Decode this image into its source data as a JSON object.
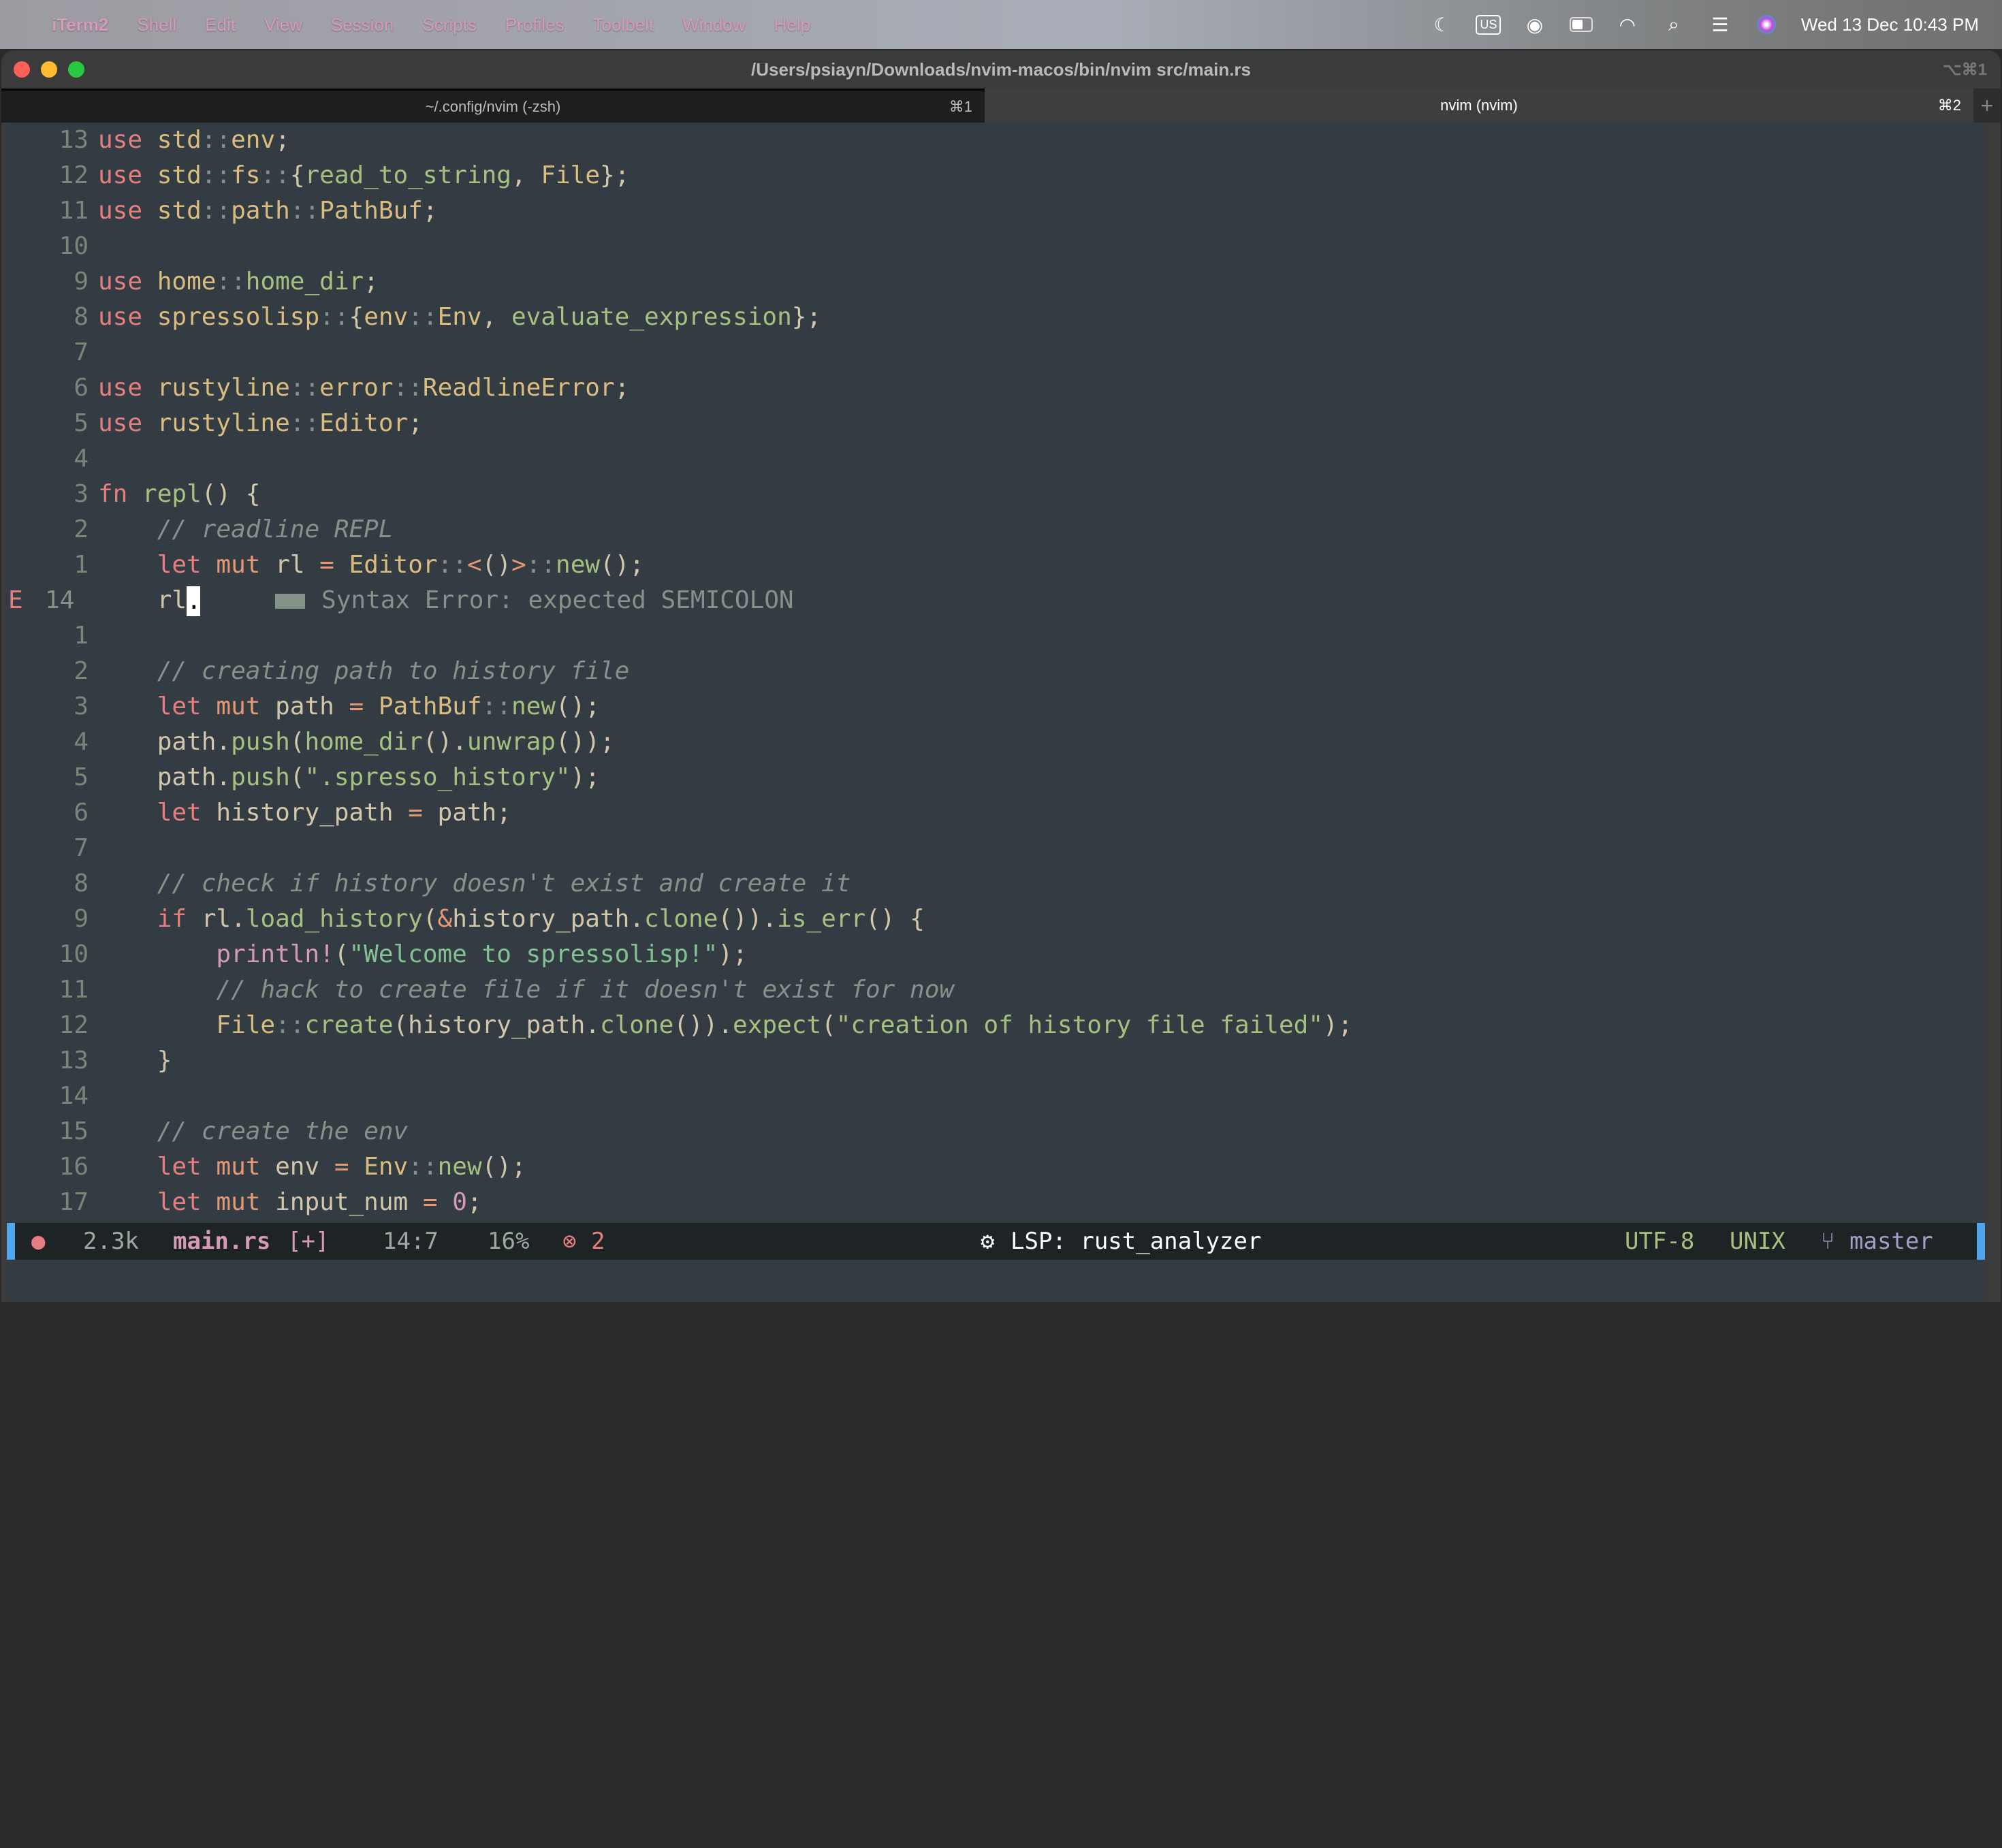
{
  "menubar": {
    "app": "iTerm2",
    "items": [
      "Shell",
      "Edit",
      "View",
      "Session",
      "Scripts",
      "Profiles",
      "Toolbelt",
      "Window",
      "Help"
    ],
    "input_source": "US",
    "datetime": "Wed 13 Dec  10:43 PM"
  },
  "window": {
    "title": "/Users/psiayn/Downloads/nvim-macos/bin/nvim src/main.rs",
    "shortcut": "⌥⌘1",
    "tabs": [
      {
        "label": "~/.config/nvim (-zsh)",
        "shortcut": "⌘1",
        "active": false
      },
      {
        "label": "nvim (nvim)",
        "shortcut": "⌘2",
        "active": true
      }
    ],
    "add_tab": "+"
  },
  "editor": {
    "lines": [
      {
        "nr": "13",
        "tokens": [
          [
            "k",
            "use"
          ],
          [
            "n",
            " "
          ],
          [
            "t",
            "std"
          ],
          [
            "p",
            "::"
          ],
          [
            "t",
            "env"
          ],
          [
            "n",
            ";"
          ]
        ]
      },
      {
        "nr": "12",
        "tokens": [
          [
            "k",
            "use"
          ],
          [
            "n",
            " "
          ],
          [
            "t",
            "std"
          ],
          [
            "p",
            "::"
          ],
          [
            "t",
            "fs"
          ],
          [
            "p",
            "::"
          ],
          [
            "n",
            "{"
          ],
          [
            "f",
            "read_to_string"
          ],
          [
            "n",
            ", "
          ],
          [
            "t",
            "File"
          ],
          [
            "n",
            "};"
          ]
        ]
      },
      {
        "nr": "11",
        "tokens": [
          [
            "k",
            "use"
          ],
          [
            "n",
            " "
          ],
          [
            "t",
            "std"
          ],
          [
            "p",
            "::"
          ],
          [
            "t",
            "path"
          ],
          [
            "p",
            "::"
          ],
          [
            "t",
            "PathBuf"
          ],
          [
            "n",
            ";"
          ]
        ]
      },
      {
        "nr": "10",
        "tokens": []
      },
      {
        "nr": "9",
        "tokens": [
          [
            "k",
            "use"
          ],
          [
            "n",
            " "
          ],
          [
            "t",
            "home"
          ],
          [
            "p",
            "::"
          ],
          [
            "f",
            "home_dir"
          ],
          [
            "n",
            ";"
          ]
        ]
      },
      {
        "nr": "8",
        "tokens": [
          [
            "k",
            "use"
          ],
          [
            "n",
            " "
          ],
          [
            "t",
            "spressolisp"
          ],
          [
            "p",
            "::"
          ],
          [
            "n",
            "{"
          ],
          [
            "t",
            "env"
          ],
          [
            "p",
            "::"
          ],
          [
            "t",
            "Env"
          ],
          [
            "n",
            ", "
          ],
          [
            "f",
            "evaluate_expression"
          ],
          [
            "n",
            "};"
          ]
        ]
      },
      {
        "nr": "7",
        "tokens": []
      },
      {
        "nr": "6",
        "tokens": [
          [
            "k",
            "use"
          ],
          [
            "n",
            " "
          ],
          [
            "t",
            "rustyline"
          ],
          [
            "p",
            "::"
          ],
          [
            "t",
            "error"
          ],
          [
            "p",
            "::"
          ],
          [
            "t",
            "ReadlineError"
          ],
          [
            "n",
            ";"
          ]
        ]
      },
      {
        "nr": "5",
        "tokens": [
          [
            "k",
            "use"
          ],
          [
            "n",
            " "
          ],
          [
            "t",
            "rustyline"
          ],
          [
            "p",
            "::"
          ],
          [
            "t",
            "Editor"
          ],
          [
            "n",
            ";"
          ]
        ]
      },
      {
        "nr": "4",
        "tokens": []
      },
      {
        "nr": "3",
        "tokens": [
          [
            "k",
            "fn"
          ],
          [
            "n",
            " "
          ],
          [
            "f",
            "repl"
          ],
          [
            "n",
            "() {"
          ]
        ]
      },
      {
        "nr": "2",
        "tokens": [
          [
            "n",
            "    "
          ],
          [
            "c",
            "// readline REPL"
          ]
        ]
      },
      {
        "nr": "1",
        "tokens": [
          [
            "n",
            "    "
          ],
          [
            "k",
            "let"
          ],
          [
            "n",
            " "
          ],
          [
            "o",
            "mut"
          ],
          [
            "n",
            " rl "
          ],
          [
            "o",
            "="
          ],
          [
            "n",
            " "
          ],
          [
            "t",
            "Editor"
          ],
          [
            "p",
            "::"
          ],
          [
            "o",
            "<"
          ],
          [
            "n",
            "()"
          ],
          [
            "o",
            ">"
          ],
          [
            "p",
            "::"
          ],
          [
            "f",
            "new"
          ],
          [
            "n",
            "();"
          ]
        ]
      },
      {
        "nr": "14",
        "current": true,
        "sign": "E",
        "tokens": [
          [
            "n",
            "    rl"
          ]
        ],
        "cursor_char": ".",
        "virtual_text": "Syntax Error: expected SEMICOLON"
      },
      {
        "nr": "1",
        "tokens": []
      },
      {
        "nr": "2",
        "tokens": [
          [
            "n",
            "    "
          ],
          [
            "c",
            "// creating path to history file"
          ]
        ]
      },
      {
        "nr": "3",
        "tokens": [
          [
            "n",
            "    "
          ],
          [
            "k",
            "let"
          ],
          [
            "n",
            " "
          ],
          [
            "o",
            "mut"
          ],
          [
            "n",
            " path "
          ],
          [
            "o",
            "="
          ],
          [
            "n",
            " "
          ],
          [
            "t",
            "PathBuf"
          ],
          [
            "p",
            "::"
          ],
          [
            "f",
            "new"
          ],
          [
            "n",
            "();"
          ]
        ]
      },
      {
        "nr": "4",
        "tokens": [
          [
            "n",
            "    path."
          ],
          [
            "f",
            "push"
          ],
          [
            "n",
            "("
          ],
          [
            "f",
            "home_dir"
          ],
          [
            "n",
            "()."
          ],
          [
            "f",
            "unwrap"
          ],
          [
            "n",
            "());"
          ]
        ]
      },
      {
        "nr": "5",
        "tokens": [
          [
            "n",
            "    path."
          ],
          [
            "f",
            "push"
          ],
          [
            "n",
            "("
          ],
          [
            "s2",
            "\".spresso_history\""
          ],
          [
            "n",
            ");"
          ]
        ]
      },
      {
        "nr": "6",
        "tokens": [
          [
            "n",
            "    "
          ],
          [
            "k",
            "let"
          ],
          [
            "n",
            " history_path "
          ],
          [
            "o",
            "="
          ],
          [
            "n",
            " path;"
          ]
        ]
      },
      {
        "nr": "7",
        "tokens": []
      },
      {
        "nr": "8",
        "tokens": [
          [
            "n",
            "    "
          ],
          [
            "c",
            "// check if history doesn't exist and create it"
          ]
        ]
      },
      {
        "nr": "9",
        "tokens": [
          [
            "n",
            "    "
          ],
          [
            "k",
            "if"
          ],
          [
            "n",
            " rl."
          ],
          [
            "f",
            "load_history"
          ],
          [
            "n",
            "("
          ],
          [
            "o",
            "&"
          ],
          [
            "n",
            "history_path."
          ],
          [
            "f",
            "clone"
          ],
          [
            "n",
            "())."
          ],
          [
            "f",
            "is_err"
          ],
          [
            "n",
            "() {"
          ]
        ]
      },
      {
        "nr": "10",
        "tokens": [
          [
            "n",
            "        "
          ],
          [
            "m",
            "println!"
          ],
          [
            "n",
            "("
          ],
          [
            "s",
            "\"Welcome to spressolisp!\""
          ],
          [
            "n",
            ");"
          ]
        ]
      },
      {
        "nr": "11",
        "tokens": [
          [
            "n",
            "        "
          ],
          [
            "c",
            "// hack to create file if it doesn't exist for now"
          ]
        ]
      },
      {
        "nr": "12",
        "tokens": [
          [
            "n",
            "        "
          ],
          [
            "t",
            "File"
          ],
          [
            "p",
            "::"
          ],
          [
            "f",
            "create"
          ],
          [
            "n",
            "(history_path."
          ],
          [
            "f",
            "clone"
          ],
          [
            "n",
            "())."
          ],
          [
            "f",
            "expect"
          ],
          [
            "n",
            "("
          ],
          [
            "s2",
            "\"creation of history file failed\""
          ],
          [
            "n",
            ");"
          ]
        ]
      },
      {
        "nr": "13",
        "tokens": [
          [
            "n",
            "    }"
          ]
        ]
      },
      {
        "nr": "14",
        "tokens": []
      },
      {
        "nr": "15",
        "tokens": [
          [
            "n",
            "    "
          ],
          [
            "c",
            "// create the env"
          ]
        ]
      },
      {
        "nr": "16",
        "tokens": [
          [
            "n",
            "    "
          ],
          [
            "k",
            "let"
          ],
          [
            "n",
            " "
          ],
          [
            "o",
            "mut"
          ],
          [
            "n",
            " env "
          ],
          [
            "o",
            "="
          ],
          [
            "n",
            " "
          ],
          [
            "t",
            "Env"
          ],
          [
            "p",
            "::"
          ],
          [
            "f",
            "new"
          ],
          [
            "n",
            "();"
          ]
        ]
      },
      {
        "nr": "17",
        "tokens": [
          [
            "n",
            "    "
          ],
          [
            "k",
            "let"
          ],
          [
            "n",
            " "
          ],
          [
            "o",
            "mut"
          ],
          [
            "n",
            " input_num "
          ],
          [
            "o",
            "="
          ],
          [
            "n",
            " "
          ],
          [
            "num",
            "0"
          ],
          [
            "n",
            ";"
          ]
        ]
      }
    ]
  },
  "statusline": {
    "size": "2.3k",
    "filename": "main.rs",
    "modified": "[+]",
    "position": "14:7",
    "percent": "16%",
    "errors": "2",
    "lsp": "LSP: rust_analyzer",
    "encoding": "UTF-8",
    "format": "UNIX",
    "branch": "master",
    "colors": {
      "accent": "#4fa6ed",
      "filename": "#d699b6",
      "error": "#e67e80",
      "encoding": "#a7c080",
      "branch": "#a39ec4"
    }
  }
}
